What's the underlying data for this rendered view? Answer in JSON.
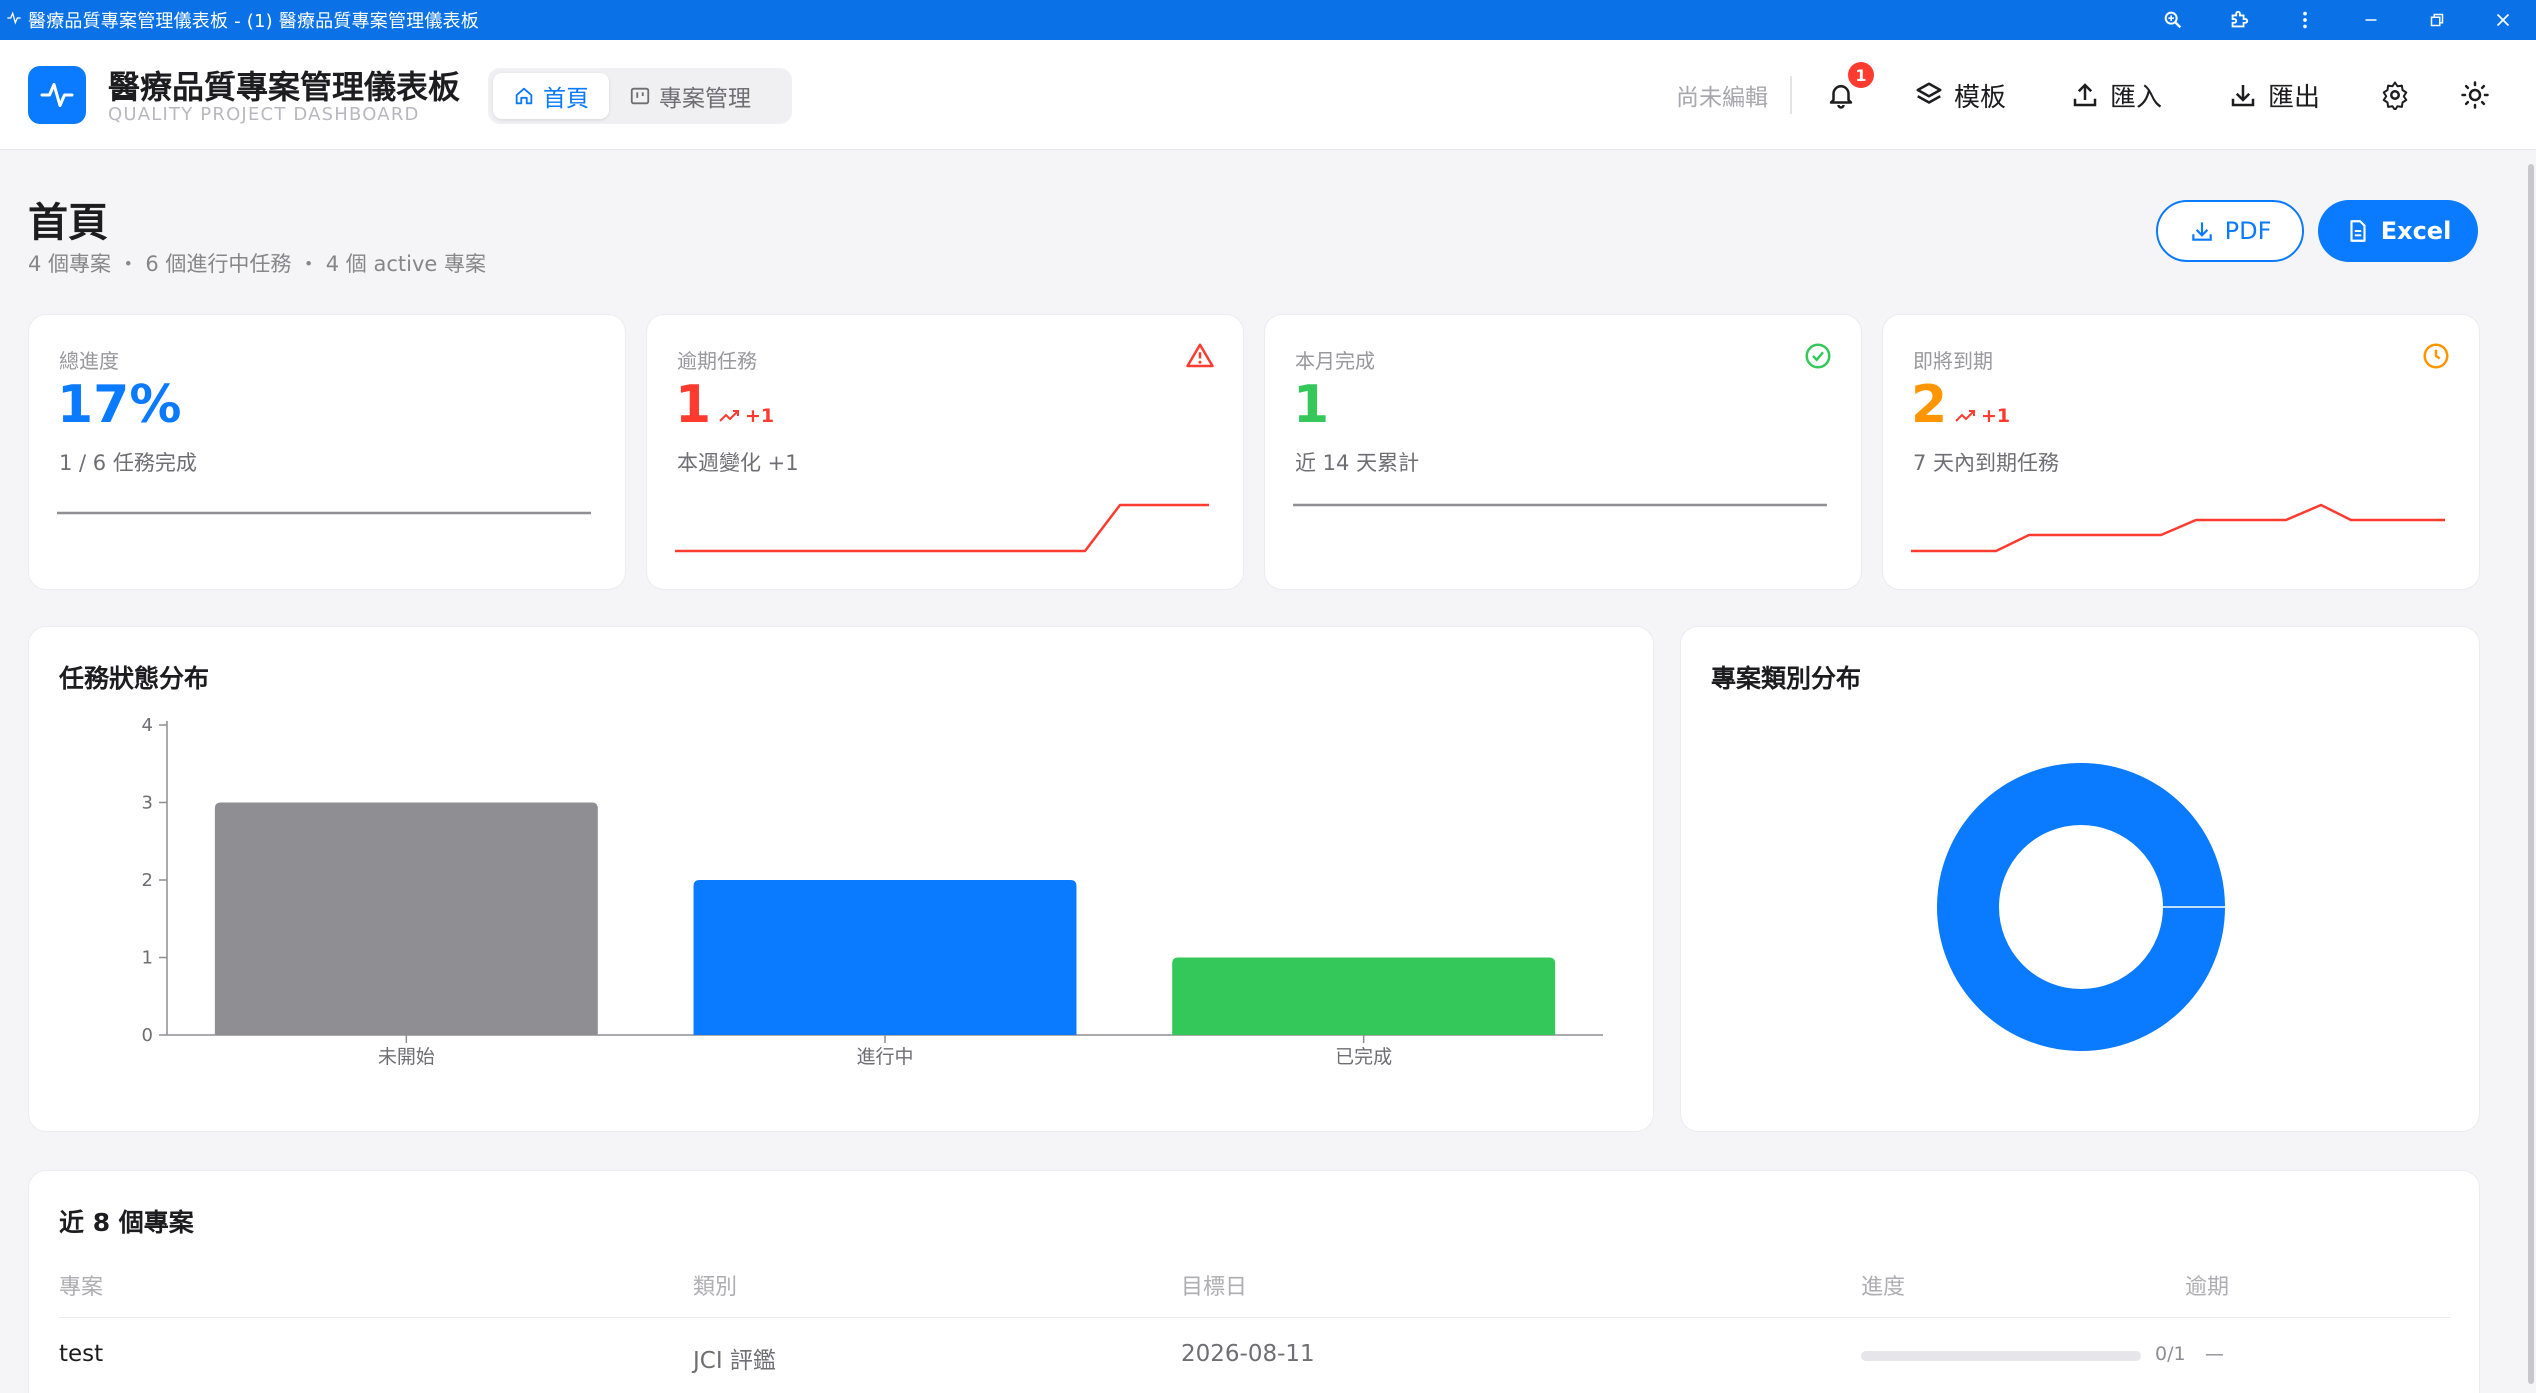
{
  "window": {
    "title": "醫療品質專案管理儀表板 - (1) 醫療品質專案管理儀表板"
  },
  "header": {
    "brand_title": "醫療品質專案管理儀表板",
    "brand_subtitle": "QUALITY PROJECT DASHBOARD",
    "tabs": [
      {
        "label": "首頁",
        "active": true
      },
      {
        "label": "專案管理",
        "active": false
      }
    ],
    "unsaved_text": "尚未編輯",
    "notification_count": "1",
    "templates_label": "模板",
    "import_label": "匯入",
    "export_label": "匯出"
  },
  "page": {
    "title": "首頁",
    "summary": "4 個專案 ・ 6 個進行中任務 ・ 4 個 active 專案",
    "pdf_label": "PDF",
    "excel_label": "Excel"
  },
  "stats": [
    {
      "label": "總進度",
      "value": "17%",
      "sub": "1 / 6 任務完成",
      "color": "#0a7aff",
      "icon": "none",
      "trend": ""
    },
    {
      "label": "逾期任務",
      "value": "1",
      "sub": "本週變化 +1",
      "color": "#ff3b30",
      "icon": "alert-triangle-icon",
      "trend": "+1"
    },
    {
      "label": "本月完成",
      "value": "1",
      "sub": "近 14 天累計",
      "color": "#34c759",
      "icon": "check-circle-icon",
      "trend": ""
    },
    {
      "label": "即將到期",
      "value": "2",
      "sub": "7 天內到期任務",
      "color": "#ff9500",
      "icon": "clock-icon",
      "trend": "+1"
    }
  ],
  "task_status": {
    "title": "任務狀態分布",
    "chart_data": {
      "type": "bar",
      "categories": [
        "未開始",
        "進行中",
        "已完成"
      ],
      "values": [
        3,
        2,
        1
      ],
      "colors": [
        "#8e8e93",
        "#0a7aff",
        "#34c759"
      ],
      "ylim": [
        0,
        4
      ],
      "yticks": [
        0,
        1,
        2,
        3,
        4
      ]
    }
  },
  "project_category": {
    "title": "專案類別分布",
    "chart_data": {
      "type": "pie",
      "values": [
        4
      ],
      "colors": [
        "#0a7aff"
      ]
    }
  },
  "recent_projects": {
    "title": "近 8 個專案",
    "columns": [
      "專案",
      "類別",
      "目標日",
      "進度",
      "逾期"
    ],
    "rows": [
      {
        "name": "test",
        "category": "JCI 評鑑",
        "target_date": "2026-08-11",
        "progress_text": "0/1",
        "progress": 0,
        "overdue": "—"
      }
    ]
  },
  "colors": {
    "accent": "#0a7aff",
    "danger": "#ff3b30",
    "success": "#34c759",
    "warning": "#ff9500",
    "neutral": "#8e8e93"
  }
}
